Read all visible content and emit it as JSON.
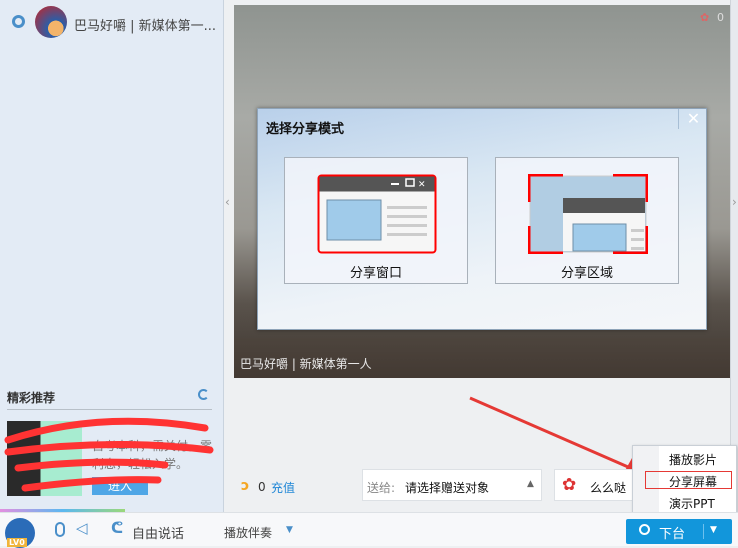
{
  "header": {
    "room_name": "巴马好嚼 | 新媒体第一..."
  },
  "video": {
    "caption": "巴马好嚼 | 新媒体第一人",
    "flower_count": "0"
  },
  "dialog": {
    "title": "选择分享模式",
    "options": [
      {
        "label": "分享窗口"
      },
      {
        "label": "分享区域"
      }
    ]
  },
  "recommend": {
    "title": "精彩推荐",
    "ad_line1": "自考本科，需关付，零",
    "ad_line2": "利息，轻松入学。",
    "enter_label": "进入"
  },
  "gift": {
    "bean_count": "0",
    "recharge_label": "充值",
    "send_to_label": "送给:",
    "send_to_value": "请选择赠送对象",
    "gift_name": "么么哒"
  },
  "menu": {
    "items": [
      "播放影片",
      "分享屏幕",
      "演示PPT"
    ]
  },
  "bottom": {
    "level_badge": "LV0",
    "free_talk_label": "自由说话",
    "accompany_label": "播放伴奏",
    "leave_stage_label": "下台"
  },
  "colors": {
    "accent": "#1296db",
    "highlight": "#e53935"
  }
}
